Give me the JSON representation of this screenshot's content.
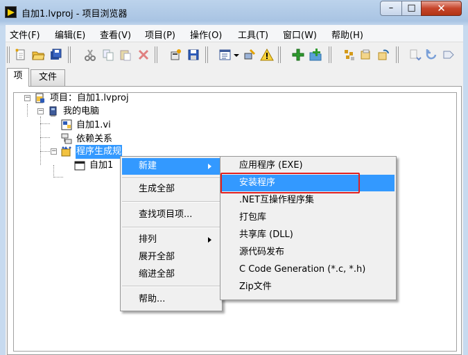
{
  "window": {
    "title": "自加1.lvproj - 项目浏览器",
    "minimize_glyph": "–",
    "maximize_glyph": "□",
    "close_glyph": "✕"
  },
  "menubar": [
    {
      "label": "文件(F)"
    },
    {
      "label": "编辑(E)"
    },
    {
      "label": "查看(V)"
    },
    {
      "label": "项目(P)"
    },
    {
      "label": "操作(O)"
    },
    {
      "label": "工具(T)"
    },
    {
      "label": "窗口(W)"
    },
    {
      "label": "帮助(H)"
    }
  ],
  "toolbar": {
    "icons": [
      "new-file-icon",
      "open-folder-icon",
      "save-all-icon",
      "cut-icon",
      "copy-icon",
      "paste-icon",
      "delete-icon",
      "properties-icon",
      "save-icon",
      "tree-view-icon",
      "warning-icon",
      "add-item-icon",
      "add-folder-icon",
      "build-icon",
      "deploy-icon",
      "refresh-icon",
      "undo-icon",
      "redo-icon",
      "forward-icon"
    ]
  },
  "tabs": [
    {
      "label": "项",
      "active": true
    },
    {
      "label": "文件",
      "active": false
    }
  ],
  "tree": {
    "project_label": "项目：自加1.lvproj",
    "my_computer": "我的电脑",
    "vi_item": "自加1.vi",
    "dependencies": "依赖关系",
    "build_specs": "程序生成规",
    "build_child": "自加1"
  },
  "context_menu": {
    "items": [
      {
        "label": "新建",
        "submenu": true,
        "highlighted": true
      },
      {
        "label": "生成全部"
      },
      {
        "label": "查找项目项..."
      },
      {
        "label": "排列",
        "submenu": true
      },
      {
        "label": "展开全部"
      },
      {
        "label": "缩进全部"
      },
      {
        "label": "帮助..."
      }
    ]
  },
  "submenu": {
    "items": [
      {
        "label": "应用程序 (EXE)"
      },
      {
        "label": "安装程序",
        "highlighted": true,
        "annotated": true
      },
      {
        "label": ".NET互操作程序集"
      },
      {
        "label": "打包库"
      },
      {
        "label": "共享库 (DLL)"
      },
      {
        "label": "源代码发布"
      },
      {
        "label": "C Code Generation (*.c, *.h)"
      },
      {
        "label": "Zip文件"
      }
    ]
  },
  "colors": {
    "selection": "#3399ff",
    "annotation_box": "#e02020",
    "close_button": "#c6452b"
  }
}
